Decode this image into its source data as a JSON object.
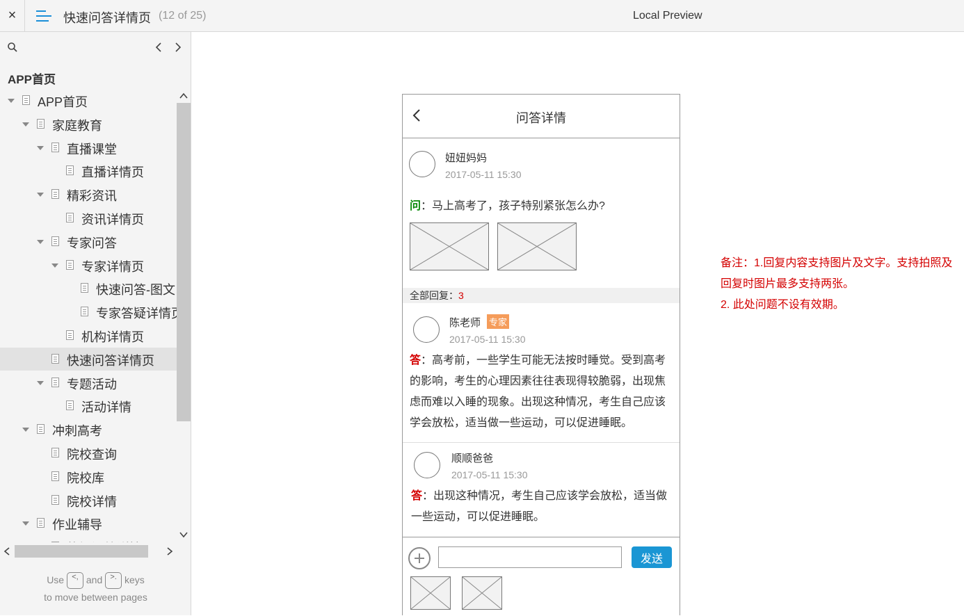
{
  "topbar": {
    "close_icon": "×",
    "title": "快速问答详情页",
    "page_count": "(12 of 25)",
    "preview_label": "Local Preview"
  },
  "sidebar": {
    "heading": "APP首页",
    "tree": [
      {
        "label": "APP首页",
        "level": 0,
        "expanded": true
      },
      {
        "label": "家庭教育",
        "level": 1,
        "expanded": true
      },
      {
        "label": "直播课堂",
        "level": 2,
        "expanded": true
      },
      {
        "label": "直播详情页",
        "level": 3
      },
      {
        "label": "精彩资讯",
        "level": 2,
        "expanded": true
      },
      {
        "label": "资讯详情页",
        "level": 3
      },
      {
        "label": "专家问答",
        "level": 2,
        "expanded": true
      },
      {
        "label": "专家详情页",
        "level": 3,
        "expanded": true
      },
      {
        "label": "快速问答-图文",
        "level": 4
      },
      {
        "label": "专家答疑详情页",
        "level": 4
      },
      {
        "label": "机构详情页",
        "level": 3
      },
      {
        "label": "快速问答详情页",
        "level": 2,
        "selected": true
      },
      {
        "label": "专题活动",
        "level": 2,
        "expanded": true
      },
      {
        "label": "活动详情",
        "level": 3
      },
      {
        "label": "冲刺高考",
        "level": 1,
        "expanded": true
      },
      {
        "label": "院校查询",
        "level": 2
      },
      {
        "label": "院校库",
        "level": 2
      },
      {
        "label": "院校详情",
        "level": 2
      },
      {
        "label": "作业辅导",
        "level": 1,
        "expanded": true
      },
      {
        "label": "热门问答详情",
        "level": 2
      }
    ],
    "help_use": "Use",
    "help_and": "and",
    "help_keys": "keys",
    "help_line2": "to move between pages",
    "key_prev": "<,",
    "key_next": ">."
  },
  "phone": {
    "title": "问答详情",
    "question": {
      "user": "妞妞妈妈",
      "time": "2017-05-11 15:30",
      "mark": "问",
      "text": "：马上高考了，孩子特别紧张怎么办?"
    },
    "reply_label": "全部回复：",
    "reply_count": "3",
    "answers": [
      {
        "user": "陈老师",
        "badge": "专家",
        "time": "2017-05-11 15:30",
        "mark": "答",
        "text": "：高考前，一些学生可能无法按时睡觉。受到高考的影响，考生的心理因素往往表现得较脆弱，出现焦虑而难以入睡的现象。出现这种情况，考生自己应该学会放松，适当做一些运动，可以促进睡眠。"
      },
      {
        "user": "顺顺爸爸",
        "time": "2017-05-11 15:30",
        "mark": "答",
        "text": "：出现这种情况，考生自己应该学会放松，适当做一些运动，可以促进睡眠。"
      }
    ],
    "input_placeholder": "",
    "send_label": "发送"
  },
  "note": {
    "line1": "备注：1.回复内容支持图片及文字。支持拍照及",
    "line2": "回复时图片最多支持两张。",
    "line3": "2. 此处问题不设有效期。"
  },
  "colors": {
    "accent": "#1a96d4",
    "question_mark": "#0a8a0a",
    "answer_mark": "#d40000",
    "badge": "#f59c5a",
    "note": "#d40000"
  }
}
